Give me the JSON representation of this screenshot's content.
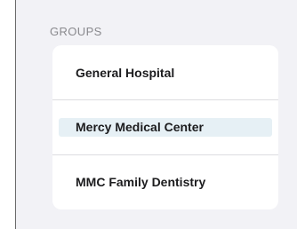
{
  "groups": {
    "header": "GROUPS",
    "items": [
      {
        "label": "General Hospital",
        "selected": false
      },
      {
        "label": "Mercy Medical Center",
        "selected": true
      },
      {
        "label": "MMC Family Dentistry",
        "selected": false
      }
    ]
  },
  "colors": {
    "background": "#f2f2f6",
    "card": "#ffffff",
    "selection_highlight": "#e6f0f5",
    "header_text": "#8a8a8e",
    "item_text": "#1c1c1e"
  }
}
